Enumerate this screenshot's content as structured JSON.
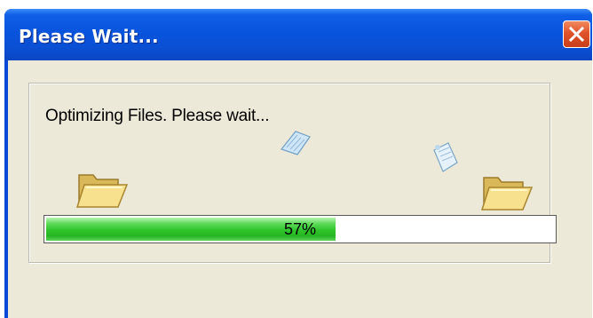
{
  "window": {
    "title": "Please Wait..."
  },
  "dialog": {
    "message": "Optimizing Files. Please wait...",
    "progress": {
      "value": 0.57,
      "label": "57%"
    }
  },
  "icons": {
    "close": "close-icon",
    "source_folder": "folder-open-icon",
    "target_folder": "folder-open-icon",
    "flying_file": "document-icon"
  },
  "colors": {
    "titlebar": "#0954dd",
    "close_button": "#e0532a",
    "client_background": "#ece9d8",
    "progress_fill": "#2fc42b"
  }
}
